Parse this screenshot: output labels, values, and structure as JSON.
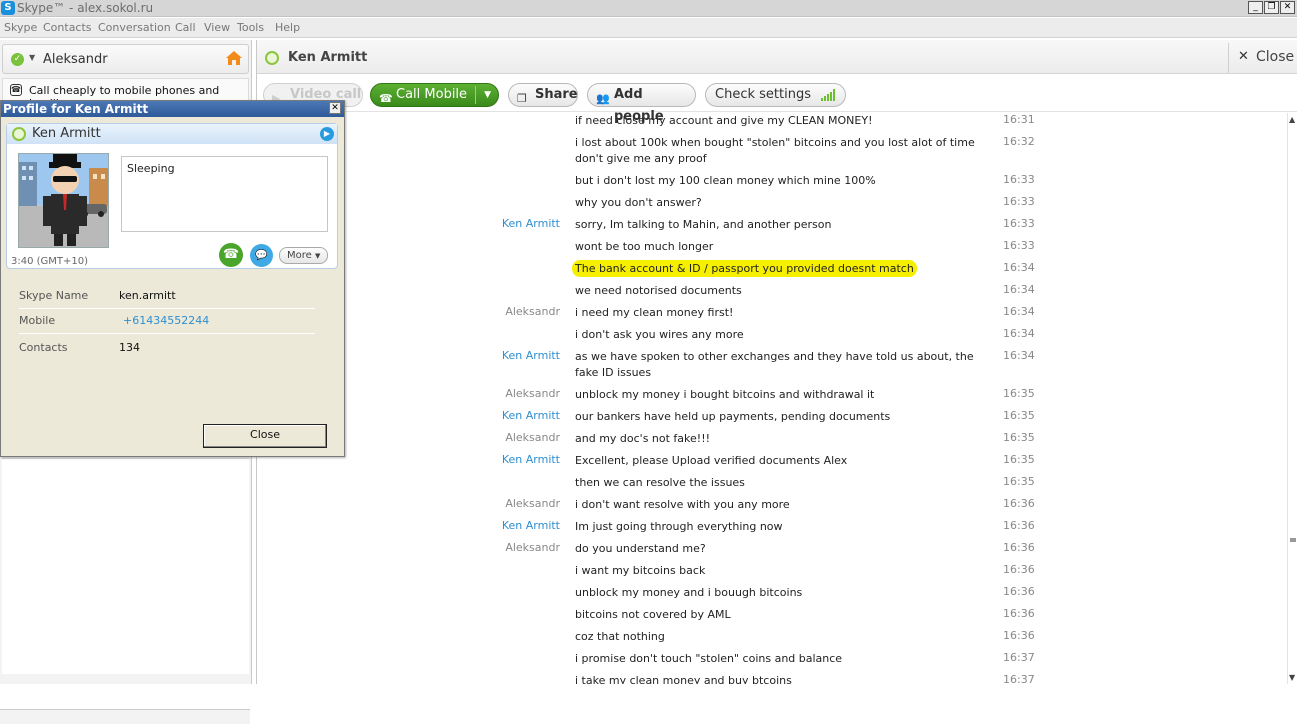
{
  "window": {
    "title": "Skype™ - alex.sokol.ru",
    "controls": [
      "_",
      "❐",
      "✕"
    ]
  },
  "menu": [
    "Skype",
    "Contacts",
    "Conversation",
    "Call",
    "View",
    "Tools",
    "Help"
  ],
  "left": {
    "user_name": "Aleksandr",
    "promo_text": "Call cheaply to mobile phones and landlines"
  },
  "profile": {
    "title": "Profile for Ken Armitt",
    "name": "Ken Armitt",
    "mood": "Sleeping",
    "more_label": "More",
    "local_time": "3:40 (GMT+10)",
    "details": [
      {
        "key": "Skype Name",
        "value": "ken.armitt"
      },
      {
        "key": "Mobile",
        "value": "+61434552244"
      },
      {
        "key": "Contacts",
        "value": "134"
      }
    ],
    "close_label": "Close"
  },
  "conversation": {
    "contact_name": "Ken Armitt",
    "close_label": "Close",
    "toolbar": {
      "video_call": "Video call",
      "call_mobile": "Call Mobile",
      "share": "Share",
      "add_people": "Add people",
      "check_settings": "Check settings"
    },
    "messages": [
      {
        "sender": "",
        "text": "if need close my account and give my CLEAN MONEY!",
        "time": "16:31"
      },
      {
        "sender": "",
        "text": "i lost about 100k when bought \"stolen\" bitcoins and you lost alot of time don't give me any proof",
        "time": "16:32"
      },
      {
        "sender": "",
        "text": "but i don't lost my 100 clean money which mine 100%",
        "time": "16:33"
      },
      {
        "sender": "",
        "text": "why you don't answer?",
        "time": "16:33"
      },
      {
        "sender": "Ken Armitt",
        "text": "sorry, Im talking to Mahin, and another person",
        "time": "16:33"
      },
      {
        "sender": "",
        "text": "wont be too much longer",
        "time": "16:33"
      },
      {
        "sender": "",
        "text": "The bank account & ID / passport you provided doesnt match",
        "time": "16:34",
        "highlight": true
      },
      {
        "sender": "",
        "text": "we need notorised documents",
        "time": "16:34"
      },
      {
        "sender": "Aleksandr",
        "text": "i need my clean money first!",
        "time": "16:34"
      },
      {
        "sender": "",
        "text": "i don't ask you wires any more",
        "time": "16:34"
      },
      {
        "sender": "Ken Armitt",
        "text": "as we have spoken to other exchanges and they have told us about, the fake ID issues",
        "time": "16:34"
      },
      {
        "sender": "Aleksandr",
        "text": "unblock my money i bought bitcoins and withdrawal it",
        "time": "16:35"
      },
      {
        "sender": "Ken Armitt",
        "text": "our bankers have held up payments, pending documents",
        "time": "16:35"
      },
      {
        "sender": "Aleksandr",
        "text": "and my doc's not fake!!!",
        "time": "16:35"
      },
      {
        "sender": "Ken Armitt",
        "text": "Excellent, please Upload verified documents Alex",
        "time": "16:35"
      },
      {
        "sender": "",
        "text": "then we can resolve the issues",
        "time": "16:35"
      },
      {
        "sender": "Aleksandr",
        "text": "i don't want resolve with you any more",
        "time": "16:36"
      },
      {
        "sender": "Ken Armitt",
        "text": "Im just going through everything now",
        "time": "16:36"
      },
      {
        "sender": "Aleksandr",
        "text": "do you understand me?",
        "time": "16:36"
      },
      {
        "sender": "",
        "text": "i want my bitcoins back",
        "time": "16:36"
      },
      {
        "sender": "",
        "text": "unblock my money and i bouugh bitcoins",
        "time": "16:36"
      },
      {
        "sender": "",
        "text": "bitcoins not covered by AML",
        "time": "16:36"
      },
      {
        "sender": "",
        "text": "coz that nothing",
        "time": "16:36"
      },
      {
        "sender": "",
        "text": "i promise don't touch \"stolen\" coins and balance",
        "time": "16:37"
      },
      {
        "sender": "",
        "text": "i take my clean money and buy btcoins",
        "time": "16:37"
      }
    ]
  },
  "colors": {
    "accent_green": "#4aa52b",
    "skype_blue": "#2e8ed0",
    "highlight": "#f6f000"
  }
}
